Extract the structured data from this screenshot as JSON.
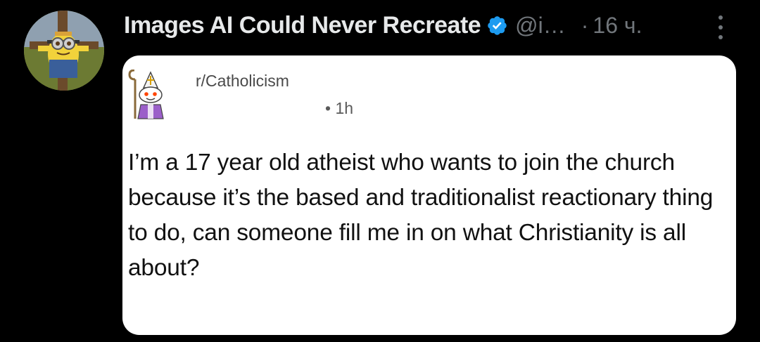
{
  "author": {
    "display_name": "Images AI Could Never Recreate",
    "handle": "@i…",
    "separator": "·",
    "time": "16 ч.",
    "verified_icon": "verified-badge-icon",
    "avatar_icon": "minion-crucifix-avatar"
  },
  "actions": {
    "more_icon": "more-options-icon"
  },
  "media": {
    "subreddit": "r/Catholicism",
    "post_time": "• 1h",
    "avatar_icon": "reddit-snoo-bishop-icon",
    "body": "I’m a 17 year old atheist who wants to join the church because it’s the based and traditionalist reactionary thing to do, can someone fill me in on what Christianity is all about?"
  },
  "colors": {
    "background": "#000000",
    "name_text": "#e7e9ea",
    "secondary_text": "#71767b",
    "verified_blue": "#1d9bf0",
    "card_bg": "#ffffff"
  }
}
